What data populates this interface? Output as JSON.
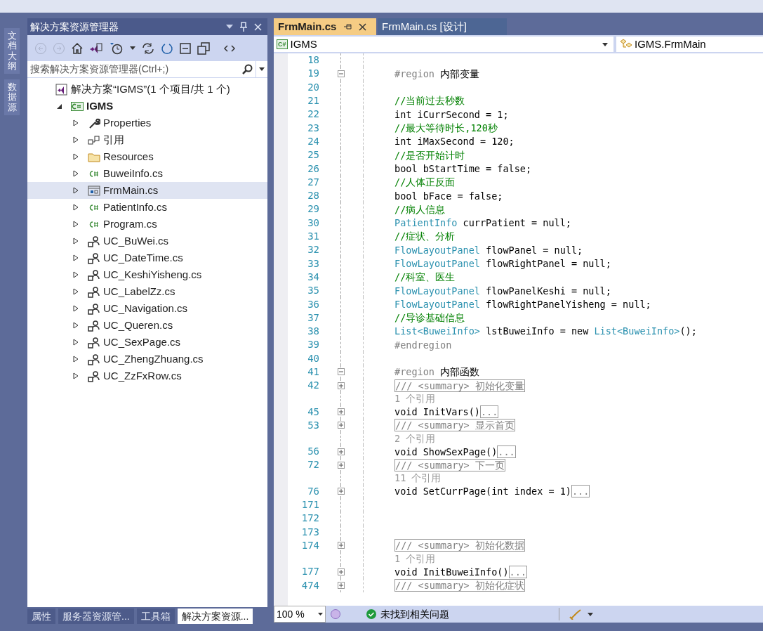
{
  "side_tabs": [
    "文档大纲",
    "数据源"
  ],
  "solution_explorer": {
    "title": "解决方案资源管理器",
    "search": {
      "placeholder": "搜索解决方案资源管理器(Ctrl+;)"
    },
    "tree": [
      {
        "label": "解决方案“IGMS”(1 个项目/共 1 个)",
        "kind": "solution",
        "selected": false,
        "children": [
          {
            "label": "IGMS",
            "kind": "csproj",
            "bold": true,
            "expanded": true,
            "selected": false,
            "children": [
              {
                "label": "Properties",
                "kind": "wrench",
                "expanded": false,
                "selected": false
              },
              {
                "label": "引用",
                "kind": "references",
                "expanded": false,
                "selected": false
              },
              {
                "label": "Resources",
                "kind": "folder",
                "expanded": false,
                "selected": false
              },
              {
                "label": "BuweiInfo.cs",
                "kind": "csfile",
                "expanded": false,
                "selected": false
              },
              {
                "label": "FrmMain.cs",
                "kind": "form",
                "expanded": false,
                "selected": true
              },
              {
                "label": "PatientInfo.cs",
                "kind": "csfile",
                "expanded": false,
                "selected": false
              },
              {
                "label": "Program.cs",
                "kind": "csfile",
                "expanded": false,
                "selected": false
              },
              {
                "label": "UC_BuWei.cs",
                "kind": "usercontrol",
                "expanded": false,
                "selected": false
              },
              {
                "label": "UC_DateTime.cs",
                "kind": "usercontrol",
                "expanded": false,
                "selected": false
              },
              {
                "label": "UC_KeshiYisheng.cs",
                "kind": "usercontrol",
                "expanded": false,
                "selected": false
              },
              {
                "label": "UC_LabelZz.cs",
                "kind": "usercontrol",
                "expanded": false,
                "selected": false
              },
              {
                "label": "UC_Navigation.cs",
                "kind": "usercontrol",
                "expanded": false,
                "selected": false
              },
              {
                "label": "UC_Queren.cs",
                "kind": "usercontrol",
                "expanded": false,
                "selected": false
              },
              {
                "label": "UC_SexPage.cs",
                "kind": "usercontrol",
                "expanded": false,
                "selected": false
              },
              {
                "label": "UC_ZhengZhuang.cs",
                "kind": "usercontrol",
                "expanded": false,
                "selected": false
              },
              {
                "label": "UC_ZzFxRow.cs",
                "kind": "usercontrol",
                "expanded": false,
                "selected": false
              }
            ]
          }
        ]
      }
    ],
    "bottom_tabs": [
      {
        "label": "属性",
        "selected": false
      },
      {
        "label": "服务器资源管...",
        "selected": false
      },
      {
        "label": "工具箱",
        "selected": false
      },
      {
        "label": "解决方案资源...",
        "selected": true
      }
    ]
  },
  "editor": {
    "tabs": [
      {
        "label": "FrmMain.cs",
        "selected": true
      },
      {
        "label": "FrmMain.cs [设计]",
        "selected": false
      }
    ],
    "project_badge": "C#",
    "project_dropdown": "IGMS",
    "class_dropdown": "IGMS.FrmMain",
    "lines": [
      {
        "num": "18"
      },
      {
        "num": "19",
        "expanded": true,
        "parts": [
          {
            "kind": "directive",
            "text": "#region "
          },
          {
            "kind": "plain",
            "text": "内部变量"
          }
        ]
      },
      {
        "num": "20"
      },
      {
        "num": "21",
        "parts": [
          {
            "kind": "comment",
            "text": "//当前过去秒数"
          }
        ]
      },
      {
        "num": "22",
        "parts": [
          {
            "kind": "plain",
            "text": "int iCurrSecond = 1;"
          }
        ]
      },
      {
        "num": "23",
        "parts": [
          {
            "kind": "comment",
            "text": "//最大等待时长,120秒"
          }
        ]
      },
      {
        "num": "24",
        "parts": [
          {
            "kind": "plain",
            "text": "int iMaxSecond = 120;"
          }
        ]
      },
      {
        "num": "25",
        "parts": [
          {
            "kind": "comment",
            "text": "//是否开始计时"
          }
        ]
      },
      {
        "num": "26",
        "parts": [
          {
            "kind": "plain",
            "text": "bool bStartTime = false;"
          }
        ]
      },
      {
        "num": "27",
        "parts": [
          {
            "kind": "comment",
            "text": "//人体正反面"
          }
        ]
      },
      {
        "num": "28",
        "parts": [
          {
            "kind": "plain",
            "text": "bool bFace = false;"
          }
        ]
      },
      {
        "num": "29",
        "parts": [
          {
            "kind": "comment",
            "text": "//病人信息"
          }
        ]
      },
      {
        "num": "30",
        "parts": [
          {
            "kind": "type",
            "text": "PatientInfo"
          },
          {
            "kind": "plain",
            "text": " currPatient = null;"
          }
        ]
      },
      {
        "num": "31",
        "parts": [
          {
            "kind": "comment",
            "text": "//症状、分析"
          }
        ]
      },
      {
        "num": "32",
        "parts": [
          {
            "kind": "type",
            "text": "FlowLayoutPanel"
          },
          {
            "kind": "plain",
            "text": " flowPanel = null;"
          }
        ]
      },
      {
        "num": "33",
        "parts": [
          {
            "kind": "type",
            "text": "FlowLayoutPanel"
          },
          {
            "kind": "plain",
            "text": " flowRightPanel = null;"
          }
        ]
      },
      {
        "num": "34",
        "parts": [
          {
            "kind": "comment",
            "text": "//科室、医生"
          }
        ]
      },
      {
        "num": "35",
        "parts": [
          {
            "kind": "type",
            "text": "FlowLayoutPanel"
          },
          {
            "kind": "plain",
            "text": " flowPanelKeshi = null;"
          }
        ]
      },
      {
        "num": "36",
        "parts": [
          {
            "kind": "type",
            "text": "FlowLayoutPanel"
          },
          {
            "kind": "plain",
            "text": " flowRightPanelYisheng = null;"
          }
        ]
      },
      {
        "num": "37",
        "parts": [
          {
            "kind": "comment",
            "text": "//导诊基础信息"
          }
        ]
      },
      {
        "num": "38",
        "parts": [
          {
            "kind": "type",
            "text": "List<BuweiInfo>"
          },
          {
            "kind": "plain",
            "text": " lstBuweiInfo = new "
          },
          {
            "kind": "type",
            "text": "List<BuweiInfo>"
          },
          {
            "kind": "plain",
            "text": "();"
          }
        ]
      },
      {
        "num": "39",
        "parts": [
          {
            "kind": "directive",
            "text": "#endregion"
          }
        ]
      },
      {
        "num": "40"
      },
      {
        "num": "41",
        "expanded": true,
        "parts": [
          {
            "kind": "directive",
            "text": "#region "
          },
          {
            "kind": "plain",
            "text": "内部函数"
          }
        ]
      },
      {
        "num": "42",
        "expanded": false,
        "parts": [
          {
            "kind": "collapsed",
            "text": "/// <summary> 初始化变量"
          }
        ]
      },
      {
        "parts": [
          {
            "kind": "lens",
            "text": "1 个引用"
          }
        ]
      },
      {
        "num": "45",
        "expanded": false,
        "parts": [
          {
            "kind": "plain",
            "text": "void InitVars()"
          },
          {
            "kind": "collapsed",
            "text": "..."
          }
        ]
      },
      {
        "num": "53",
        "expanded": false,
        "parts": [
          {
            "kind": "collapsed",
            "text": "/// <summary> 显示首页"
          }
        ]
      },
      {
        "parts": [
          {
            "kind": "lens",
            "text": "2 个引用"
          }
        ]
      },
      {
        "num": "56",
        "expanded": false,
        "parts": [
          {
            "kind": "plain",
            "text": "void ShowSexPage()"
          },
          {
            "kind": "collapsed",
            "text": "..."
          }
        ]
      },
      {
        "num": "72",
        "expanded": false,
        "parts": [
          {
            "kind": "collapsed",
            "text": "/// <summary> 下一页"
          }
        ]
      },
      {
        "parts": [
          {
            "kind": "lens",
            "text": "11 个引用"
          }
        ]
      },
      {
        "num": "76",
        "expanded": false,
        "parts": [
          {
            "kind": "plain",
            "text": "void SetCurrPage(int index = 1)"
          },
          {
            "kind": "collapsed",
            "text": "..."
          }
        ]
      },
      {
        "num": "171"
      },
      {
        "num": "172"
      },
      {
        "num": "173"
      },
      {
        "num": "174",
        "expanded": false,
        "parts": [
          {
            "kind": "collapsed",
            "text": "/// <summary> 初始化数据"
          }
        ]
      },
      {
        "parts": [
          {
            "kind": "lens",
            "text": "1 个引用"
          }
        ]
      },
      {
        "num": "177",
        "expanded": false,
        "parts": [
          {
            "kind": "plain",
            "text": "void InitBuweiInfo()"
          },
          {
            "kind": "collapsed",
            "text": "..."
          }
        ]
      },
      {
        "num": "474",
        "expanded": false,
        "parts": [
          {
            "kind": "collapsed",
            "text": "/// <summary> 初始化症状"
          }
        ]
      }
    ],
    "status": {
      "zoom": "100 %",
      "issues": "未找到相关问题"
    }
  }
}
